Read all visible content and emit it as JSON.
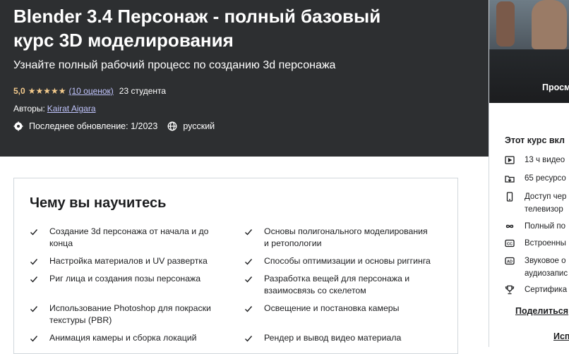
{
  "course": {
    "title_line1": "Blender 3.4 Персонаж - полный базовый",
    "title_line2": "курс 3D моделирования",
    "subtitle": "Узнайте полный рабочий процесс по созданию 3d персонажа",
    "rating": "5,0",
    "stars": "★★★★★",
    "rating_link": "(10 оценок)",
    "students": "23 студента",
    "authors_label": "Авторы:",
    "author": "Kairat Aigara",
    "last_update": "Последнее обновление: 1/2023",
    "language": "русский"
  },
  "learn": {
    "title": "Чему вы научитесь",
    "left": [
      "Создание 3d персонажа от начала и до конца",
      "Настройка материалов и UV развертка",
      "Риг лица и создания позы персонажа",
      "Использование Photoshop для покраски текстуры (PBR)",
      "Анимация камеры и сборка локаций"
    ],
    "right": [
      "Основы полигонального моделирования и ретопологии",
      "Способы оптимизации и основы риггинга",
      "Разработка вещей для персонажа и взаимосвязь со скелетом",
      "Освещение и постановка камеры",
      "Рендер и вывод видео материала"
    ]
  },
  "sidebar": {
    "preview_label": "Просм",
    "includes_title": "Этот курс вкл",
    "items": [
      {
        "line1": "13 ч видео",
        "line2": "",
        "icon": "video-icon"
      },
      {
        "line1": "65 ресурсо",
        "line2": "",
        "icon": "download-icon"
      },
      {
        "line1": "Доступ чер",
        "line2": "телевизор",
        "icon": "mobile-icon"
      },
      {
        "line1": "Полный по",
        "line2": "",
        "icon": "infinity-icon"
      },
      {
        "line1": "Встроенны",
        "line2": "",
        "icon": "cc-icon"
      },
      {
        "line1": "Звуковое о",
        "line2": "аудиозапис",
        "icon": "ad-icon"
      },
      {
        "line1": "Сертифика",
        "line2": "",
        "icon": "trophy-icon"
      }
    ],
    "share": "Поделиться",
    "isp": "Исп"
  }
}
